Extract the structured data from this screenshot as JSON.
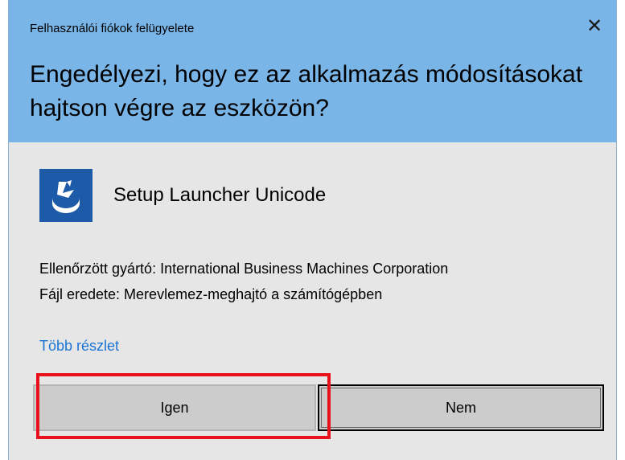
{
  "dialog": {
    "window_title": "Felhasználói fiókok felügyelete",
    "close_glyph": "✕",
    "question": "Engedélyezi, hogy ez az alkalmazás módosításokat hajtson végre az eszközön?",
    "app_name": "Setup Launcher Unicode",
    "app_icon": "setup-launcher-icon",
    "publisher_line": "Ellenőrzött gyártó: International Business Machines Corporation",
    "origin_line": "Fájl eredete: Merevlemez-meghajtó a számítógépben",
    "more_details": "Több részlet",
    "yes_label": "Igen",
    "no_label": "Nem"
  },
  "colors": {
    "header_bg": "#7ab5e8",
    "body_bg": "#e6e6e6",
    "icon_bg": "#1d5aa8",
    "link": "#1a74d6",
    "highlight": "#e8101a"
  }
}
